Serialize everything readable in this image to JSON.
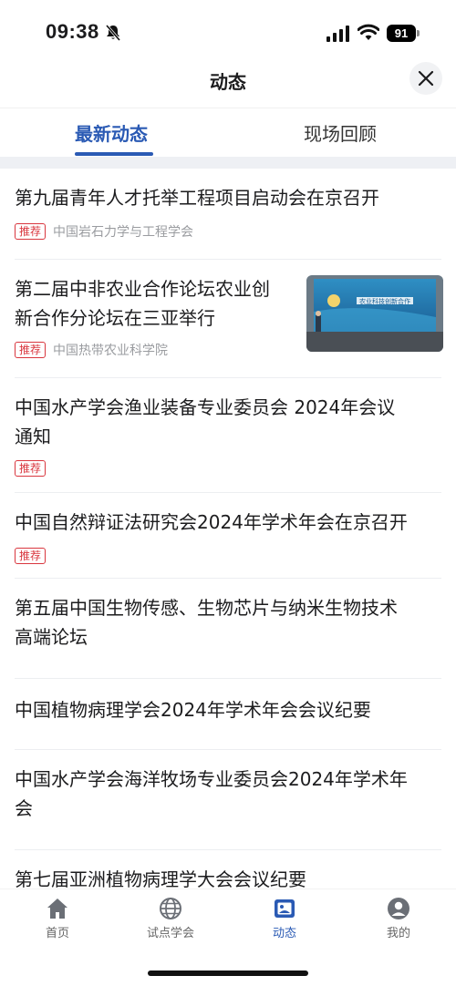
{
  "status": {
    "time": "09:38",
    "battery": "91"
  },
  "header": {
    "title": "动态"
  },
  "tabs": [
    {
      "label": "最新动态",
      "active": true
    },
    {
      "label": "现场回顾",
      "active": false
    }
  ],
  "news": [
    {
      "title_lines": [
        "第九届青年人才托举工程项目启动会在京召开"
      ],
      "tag": "推荐",
      "source": "中国岩石力学与工程学会"
    },
    {
      "title_lines": [
        "第二届中非农业合作论坛农业创",
        "新合作分论坛在三亚举行"
      ],
      "tag": "推荐",
      "source": "中国热带农业科学院",
      "thumbnail": {
        "banner_text": "农业科技创新合作"
      }
    },
    {
      "title_lines": [
        "中国水产学会渔业装备专业委员会 2024年会议",
        "通知"
      ],
      "tag": "推荐",
      "source": ""
    },
    {
      "title_lines": [
        "中国自然辩证法研究会2024年学术年会在京召开"
      ],
      "tag": "推荐",
      "source": ""
    },
    {
      "title_lines": [
        "第五届中国生物传感、生物芯片与纳米生物技术",
        "高端论坛"
      ],
      "tag": "",
      "source": ""
    },
    {
      "title_lines": [
        "中国植物病理学会2024年学术年会会议纪要"
      ],
      "tag": "",
      "source": ""
    },
    {
      "title_lines": [
        "中国水产学会海洋牧场专业委员会2024年学术年",
        "会"
      ],
      "tag": "",
      "source": ""
    },
    {
      "title_lines": [
        "第七届亚洲植物病理学大会会议纪要"
      ],
      "tag": "",
      "source": ""
    }
  ],
  "tabbar": [
    {
      "label": "首页",
      "icon": "home-icon",
      "active": false
    },
    {
      "label": "试点学会",
      "icon": "globe-icon",
      "active": false
    },
    {
      "label": "动态",
      "icon": "news-icon",
      "active": true
    },
    {
      "label": "我的",
      "icon": "profile-icon",
      "active": false
    }
  ],
  "colors": {
    "accent": "#2a5ab4",
    "tag_red": "#d9363e",
    "separator": "#eef0f4"
  }
}
